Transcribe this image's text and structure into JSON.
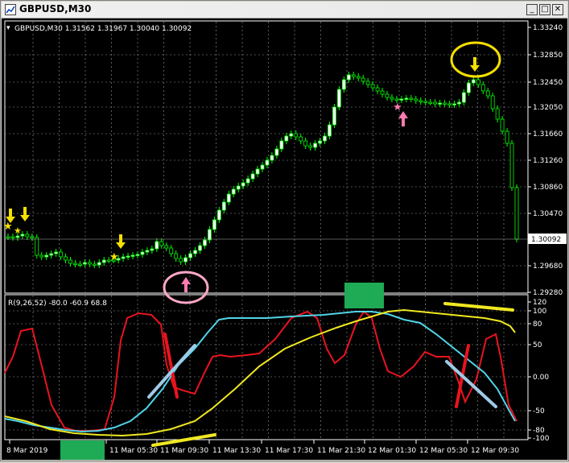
{
  "window": {
    "title": "GBPUSD,M30",
    "minimize_glyph": "_",
    "maximize_glyph": "□",
    "close_glyph": "✕"
  },
  "chart": {
    "symbol_info": "GBPUSD,M30  1.31562 1.31967 1.30040 1.30092",
    "current_price": "1.30092",
    "indicator_info": "R(9,26,52) -80.0 -60.9 68.8",
    "price_ticks": [
      "1.33240",
      "1.32850",
      "1.32450",
      "1.32050",
      "1.31660",
      "1.31260",
      "1.30860",
      "1.30470",
      "1.30092",
      "1.29680",
      "1.29280"
    ],
    "indicator_ticks": [
      "120",
      "100",
      "80",
      "50",
      "0.00",
      "-50",
      "-80",
      "-100"
    ],
    "time_ticks": [
      "8 Mar 2019",
      "11 Mar 05:30",
      "11 Mar 09:30",
      "11 Mar 13:30",
      "11 Mar 17:30",
      "11 Mar 21:30",
      "12 Mar 01:30",
      "12 Mar 05:30",
      "12 Mar 09:30"
    ],
    "colors": {
      "background": "#000000",
      "grid": "#9a9a9a",
      "candle": "#00ff00",
      "line_red": "#e8141e",
      "line_cyan": "#4fd4e8",
      "line_yellow": "#f0e820",
      "arrow_yellow": "#f5e000",
      "arrow_pink": "#ff7ab0",
      "marker_green": "#1faa55"
    }
  }
}
